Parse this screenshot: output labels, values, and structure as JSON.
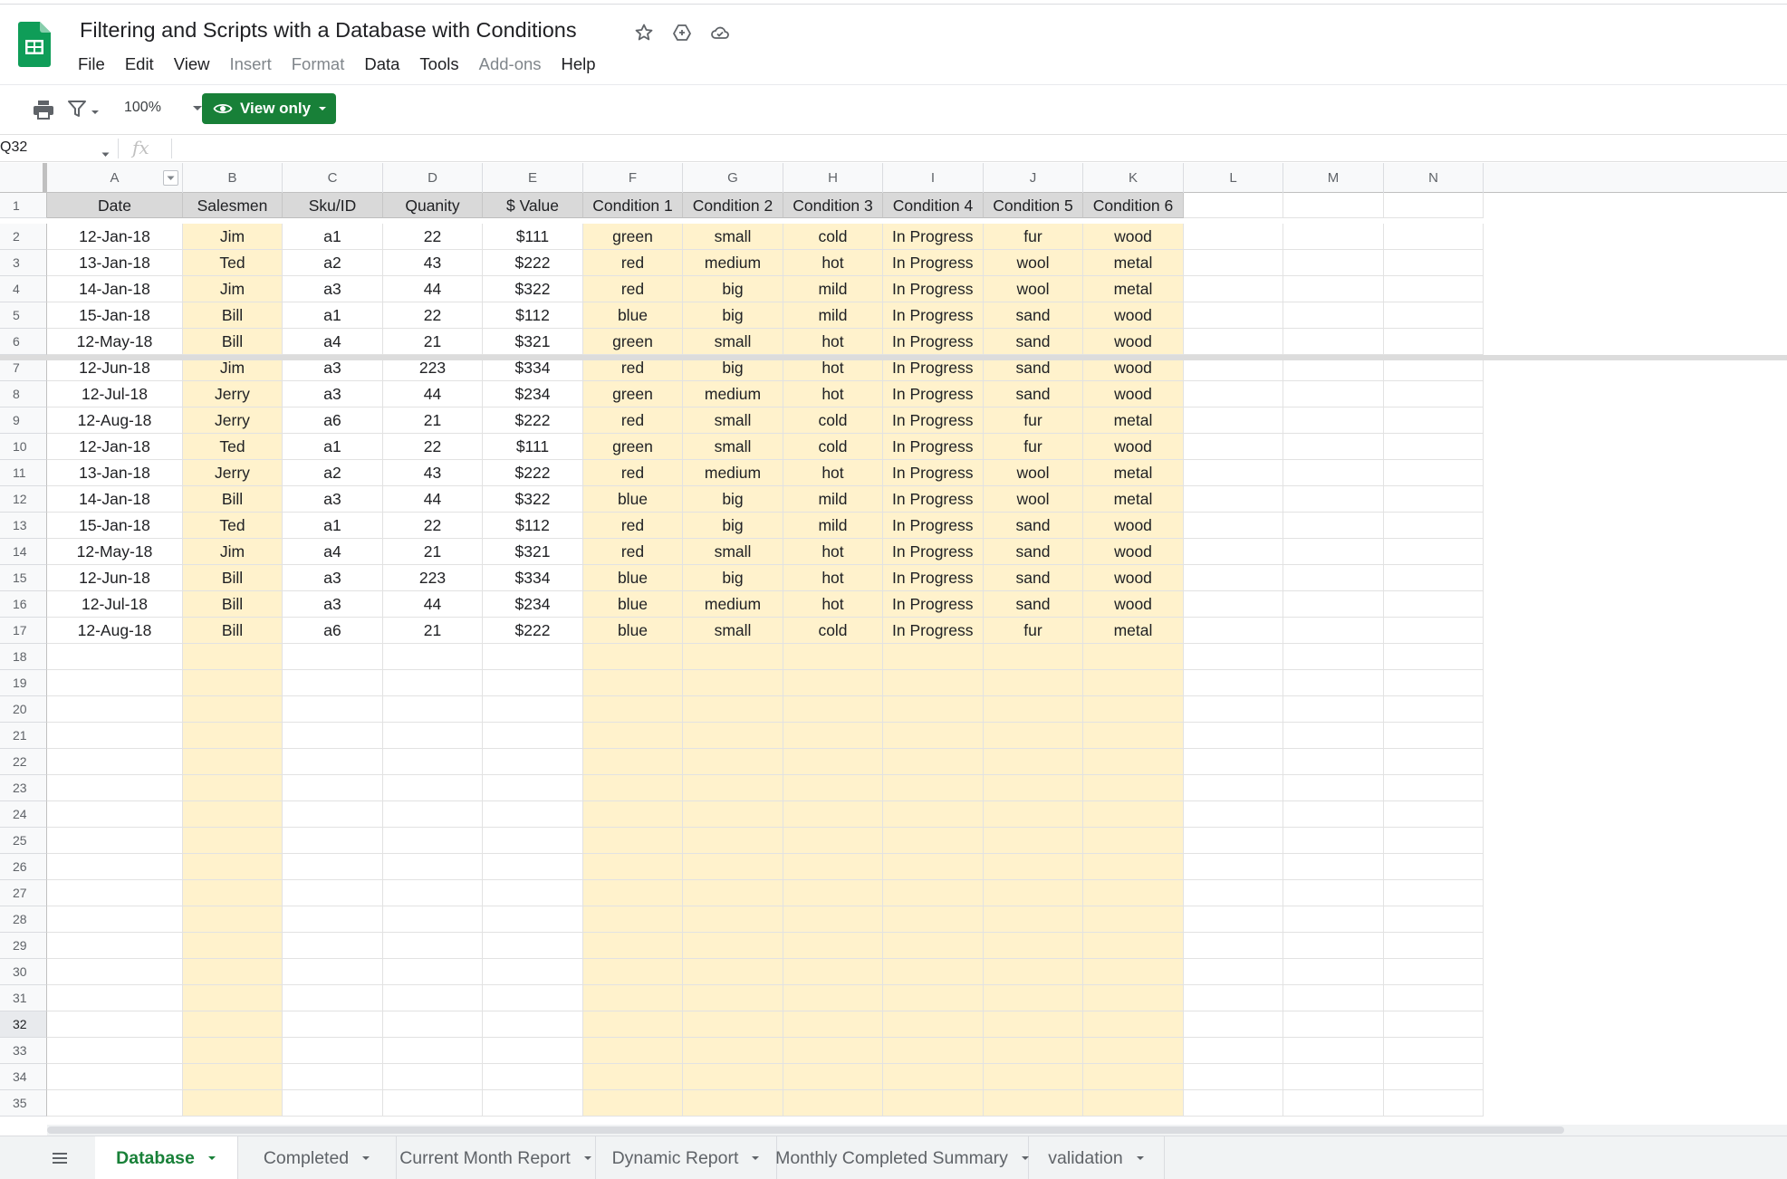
{
  "doc": {
    "title": "Filtering and Scripts with a Database with Conditions",
    "menu": [
      {
        "label": "File",
        "disabled": false
      },
      {
        "label": "Edit",
        "disabled": false
      },
      {
        "label": "View",
        "disabled": false
      },
      {
        "label": "Insert",
        "disabled": true
      },
      {
        "label": "Format",
        "disabled": true
      },
      {
        "label": "Data",
        "disabled": false
      },
      {
        "label": "Tools",
        "disabled": false
      },
      {
        "label": "Add-ons",
        "disabled": true
      },
      {
        "label": "Help",
        "disabled": false
      }
    ]
  },
  "toolbar": {
    "zoom": "100%",
    "view_only_label": "View only"
  },
  "formula_bar": {
    "name_box": "Q32",
    "fx_label": "fx"
  },
  "grid": {
    "columns": [
      "A",
      "B",
      "C",
      "D",
      "E",
      "F",
      "G",
      "H",
      "I",
      "J",
      "K",
      "L",
      "M",
      "N"
    ],
    "headers": [
      "Date",
      "Salesmen",
      "Sku/ID",
      "Quanity",
      "$ Value",
      "Condition 1",
      "Condition 2",
      "Condition 3",
      "Condition 4",
      "Condition 5",
      "Condition 6"
    ],
    "rows": [
      [
        "12-Jan-18",
        "Jim",
        "a1",
        "22",
        "$111",
        "green",
        "small",
        "cold",
        "In Progress",
        "fur",
        "wood"
      ],
      [
        "13-Jan-18",
        "Ted",
        "a2",
        "43",
        "$222",
        "red",
        "medium",
        "hot",
        "In Progress",
        "wool",
        "metal"
      ],
      [
        "14-Jan-18",
        "Jim",
        "a3",
        "44",
        "$322",
        "red",
        "big",
        "mild",
        "In Progress",
        "wool",
        "metal"
      ],
      [
        "15-Jan-18",
        "Bill",
        "a1",
        "22",
        "$112",
        "blue",
        "big",
        "mild",
        "In Progress",
        "sand",
        "wood"
      ],
      [
        "12-May-18",
        "Bill",
        "a4",
        "21",
        "$321",
        "green",
        "small",
        "hot",
        "In Progress",
        "sand",
        "wood"
      ],
      [
        "12-Jun-18",
        "Jim",
        "a3",
        "223",
        "$334",
        "red",
        "big",
        "hot",
        "In Progress",
        "sand",
        "wood"
      ],
      [
        "12-Jul-18",
        "Jerry",
        "a3",
        "44",
        "$234",
        "green",
        "medium",
        "hot",
        "In Progress",
        "sand",
        "wood"
      ],
      [
        "12-Aug-18",
        "Jerry",
        "a6",
        "21",
        "$222",
        "red",
        "small",
        "cold",
        "In Progress",
        "fur",
        "metal"
      ],
      [
        "12-Jan-18",
        "Ted",
        "a1",
        "22",
        "$111",
        "green",
        "small",
        "cold",
        "In Progress",
        "fur",
        "wood"
      ],
      [
        "13-Jan-18",
        "Jerry",
        "a2",
        "43",
        "$222",
        "red",
        "medium",
        "hot",
        "In Progress",
        "wool",
        "metal"
      ],
      [
        "14-Jan-18",
        "Bill",
        "a3",
        "44",
        "$322",
        "blue",
        "big",
        "mild",
        "In Progress",
        "wool",
        "metal"
      ],
      [
        "15-Jan-18",
        "Ted",
        "a1",
        "22",
        "$112",
        "red",
        "big",
        "mild",
        "In Progress",
        "sand",
        "wood"
      ],
      [
        "12-May-18",
        "Jim",
        "a4",
        "21",
        "$321",
        "red",
        "small",
        "hot",
        "In Progress",
        "sand",
        "wood"
      ],
      [
        "12-Jun-18",
        "Bill",
        "a3",
        "223",
        "$334",
        "blue",
        "big",
        "hot",
        "In Progress",
        "sand",
        "wood"
      ],
      [
        "12-Jul-18",
        "Bill",
        "a3",
        "44",
        "$234",
        "blue",
        "medium",
        "hot",
        "In Progress",
        "sand",
        "wood"
      ],
      [
        "12-Aug-18",
        "Bill",
        "a6",
        "21",
        "$222",
        "blue",
        "small",
        "cold",
        "In Progress",
        "fur",
        "metal"
      ]
    ],
    "row_numbers": [
      "1",
      "2",
      "3",
      "4",
      "5",
      "6",
      "7",
      "8",
      "9",
      "10",
      "11",
      "12",
      "13",
      "14",
      "15",
      "16",
      "17",
      "18",
      "19",
      "20",
      "21",
      "22",
      "23",
      "24",
      "25",
      "26",
      "27",
      "28",
      "29",
      "30",
      "31",
      "32",
      "33",
      "34",
      "35"
    ],
    "active_row": "32",
    "highlight_color": "#fff2cc",
    "header_fill": "#d9d9d9"
  },
  "tabs": [
    {
      "label": "Database",
      "active": true
    },
    {
      "label": "Completed",
      "active": false
    },
    {
      "label": "Current Month Report",
      "active": false
    },
    {
      "label": "Dynamic Report",
      "active": false
    },
    {
      "label": "Monthly Completed Summary",
      "active": false
    },
    {
      "label": "validation",
      "active": false
    }
  ],
  "colors": {
    "brand_green": "#188038",
    "sheets_green": "#0f9d58"
  }
}
